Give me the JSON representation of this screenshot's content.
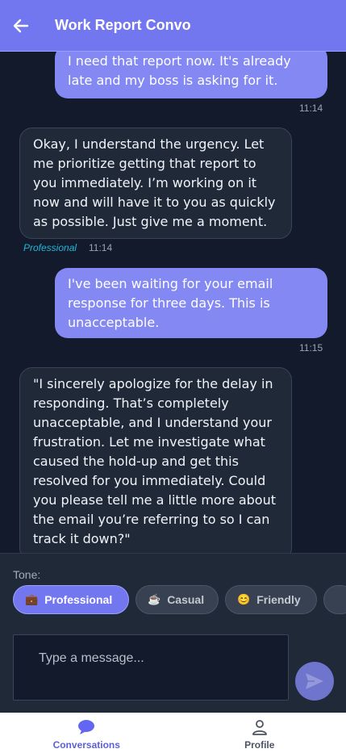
{
  "header": {
    "title": "Work Report Convo"
  },
  "messages": [
    {
      "role": "user",
      "text": "I need that report now. It's already late and my boss is asking for it.",
      "time": "11:14"
    },
    {
      "role": "bot",
      "text": "Okay, I understand the urgency. Let me prioritize getting that report to you immediately. I’m working on it now and will have it to you as quickly as possible. Just give me a moment.",
      "tone": "Professional",
      "time": "11:14"
    },
    {
      "role": "user",
      "text": "I've been waiting for your email response for three days. This is unacceptable.",
      "time": "11:15"
    },
    {
      "role": "bot",
      "text": "\"I sincerely apologize for the delay in responding. That’s completely unacceptable, and I understand your frustration. Let me investigate what caused the hold-up and get this resolved for you immediately. Could you please tell me a little more about the email you’re referring to so I can track it down?\""
    }
  ],
  "composer": {
    "tone_label": "Tone:",
    "tones": [
      {
        "emoji": "💼",
        "label": "Professional",
        "active": true
      },
      {
        "emoji": "☕",
        "label": "Casual",
        "active": false
      },
      {
        "emoji": "😊",
        "label": "Friendly",
        "active": false
      }
    ],
    "input_placeholder": "Type a message..."
  },
  "nav": {
    "conversations": "Conversations",
    "profile": "Profile"
  },
  "colors": {
    "accent": "#7277f0",
    "background": "#121a2b",
    "bot_bubble": "#1f2938",
    "user_bubble": "#8388f3",
    "tone_tag": "#22b8d8"
  },
  "icons": {
    "back": "arrow-left-icon",
    "send": "send-icon",
    "conversations": "chat-bubble-icon",
    "profile": "user-icon"
  }
}
